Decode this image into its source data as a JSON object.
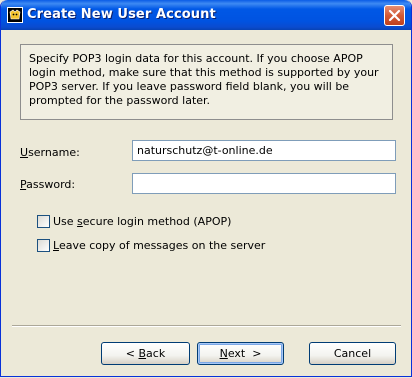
{
  "window": {
    "title": "Create New User Account"
  },
  "info": {
    "text": "Specify POP3 login data for this account. If you choose APOP login method, make sure that this method is supported by your POP3 server. If you leave password field blank, you will be prompted for the password later."
  },
  "form": {
    "username_label": "sername:",
    "username_mnemonic": "U",
    "username_value": "naturschutz@t-online.de",
    "password_label": "assword:",
    "password_mnemonic": "P",
    "password_value": ""
  },
  "options": {
    "apop_pre": "Use ",
    "apop_mnemonic": "s",
    "apop_post": "ecure login method (APOP)",
    "apop_checked": false,
    "leave_copy_mnemonic": "L",
    "leave_copy_post": "eave copy of messages on the server",
    "leave_copy_checked": false
  },
  "buttons": {
    "back_pre": "< ",
    "back_mnemonic": "B",
    "back_post": "ack",
    "next_mnemonic": "N",
    "next_post": "ext  >",
    "cancel_label": "Cancel"
  },
  "colors": {
    "titlebar": "#0054e3",
    "dialog_bg": "#ece9d8",
    "close_button": "#d25a36"
  }
}
